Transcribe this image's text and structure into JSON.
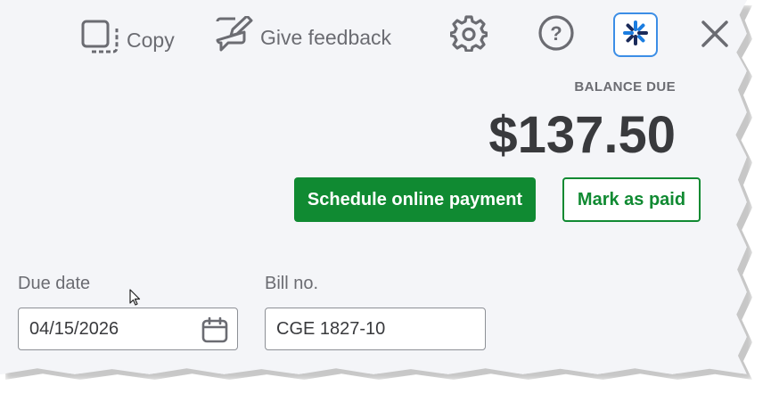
{
  "toolbar": {
    "copy_label": "Copy",
    "feedback_label": "Give feedback",
    "settings_icon": "gear-icon",
    "help_icon": "help-icon",
    "assistant_icon": "assistant-icon",
    "close_icon": "close-icon"
  },
  "balance": {
    "label": "BALANCE DUE",
    "amount": "$137.50"
  },
  "actions": {
    "schedule_label": "Schedule online payment",
    "mark_paid_label": "Mark as paid"
  },
  "fields": {
    "due_date": {
      "label": "Due date",
      "value": "04/15/2026"
    },
    "bill_no": {
      "label": "Bill no.",
      "value": "CGE 1827-10"
    }
  },
  "colors": {
    "accent_green": "#108a32",
    "text_dark": "#393a3d",
    "text_muted": "#6b6c72",
    "background": "#f4f5f8"
  }
}
